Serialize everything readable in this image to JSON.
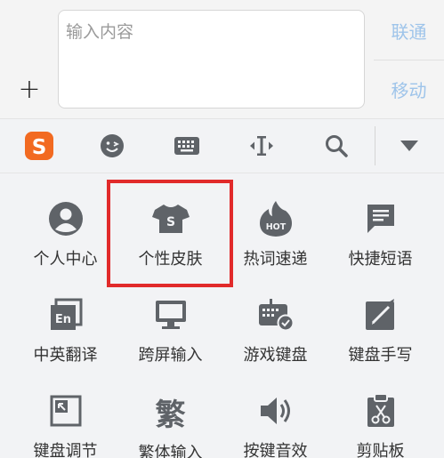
{
  "input": {
    "placeholder": "输入内容"
  },
  "side": {
    "link_label": "联通",
    "move_label": "移动"
  },
  "plus": {
    "label": "+"
  },
  "toolbar": {
    "items": [
      "sogou-logo-icon",
      "emoji-icon",
      "keyboard-icon",
      "cursor-move-icon",
      "search-icon",
      "collapse-icon"
    ],
    "logo_letter": "S"
  },
  "grid": {
    "row1": [
      {
        "label": "个人中心",
        "icon": "user-icon"
      },
      {
        "label": "个性皮肤",
        "icon": "skin-shirt-icon",
        "icon_letter": "S"
      },
      {
        "label": "热词速递",
        "icon": "hot-flame-icon",
        "icon_text": "HOT"
      },
      {
        "label": "快捷短语",
        "icon": "message-icon"
      }
    ],
    "row2": [
      {
        "label": "中英翻译",
        "icon": "translate-icon",
        "icon_text": "En"
      },
      {
        "label": "跨屏输入",
        "icon": "monitor-icon"
      },
      {
        "label": "游戏键盘",
        "icon": "game-keyboard-icon"
      },
      {
        "label": "键盘手写",
        "icon": "handwrite-icon"
      }
    ],
    "row3": [
      {
        "label": "键盘调节",
        "icon": "resize-icon"
      },
      {
        "label": "繁体输入",
        "icon": "traditional-icon",
        "icon_text": "繁"
      },
      {
        "label": "按键音效",
        "icon": "speaker-icon"
      },
      {
        "label": "剪贴板",
        "icon": "clipboard-icon"
      }
    ]
  },
  "colors": {
    "accent_orange": "#f26a21",
    "icon_gray": "#5f6368",
    "highlight_red": "#e12a2a",
    "side_blue": "#9ec4ea"
  }
}
